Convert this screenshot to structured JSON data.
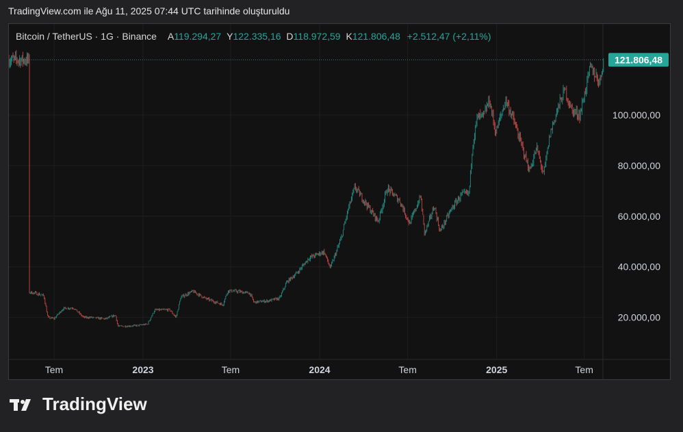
{
  "header": {
    "title": "TradingView.com ile Ağu 11, 2025 07:44 UTC tarihinde oluşturuldu"
  },
  "legend": {
    "symbol": "Bitcoin / TetherUS · 1G · Binance",
    "open_label": "A",
    "open": "119.294,27",
    "high_label": "Y",
    "high": "122.335,16",
    "low_label": "D",
    "low": "118.972,59",
    "close_label": "K",
    "close": "121.806,48",
    "change": "+2.512,47 (+2,11%)"
  },
  "price_tag": "121.806,48",
  "brand": {
    "name": "TradingView"
  },
  "colors": {
    "up": "#26a69a",
    "down": "#ef5350",
    "background": "#121213",
    "grid": "#1f1f21",
    "axis_text": "#d1d4dc"
  },
  "chart_data": {
    "type": "line",
    "style": "candlestick",
    "interval": "1 day",
    "x_tick_labels": [
      "Tem",
      "2023",
      "Tem",
      "2024",
      "Tem",
      "2025",
      "Tem"
    ],
    "y_tick_labels": [
      "20.000,00",
      "40.000,00",
      "60.000,00",
      "80.000,00",
      "100.000,00"
    ],
    "ylim": [
      0,
      135000
    ],
    "grid": true,
    "last_price": 121806.48,
    "series": [
      {
        "x": [
          "2022-05-10",
          "2022-05-25",
          "2022-06-10",
          "2022-06-18",
          "2022-07-01",
          "2022-07-20",
          "2022-08-10",
          "2022-08-31",
          "2022-09-15",
          "2022-10-15",
          "2022-11-05",
          "2022-11-10",
          "2022-11-25",
          "2022-12-20",
          "2023-01-10",
          "2023-01-25",
          "2023-02-25",
          "2023-03-10",
          "2023-03-20",
          "2023-04-14",
          "2023-05-10",
          "2023-06-15",
          "2023-06-25",
          "2023-07-15",
          "2023-08-10",
          "2023-08-18",
          "2023-09-15",
          "2023-10-10",
          "2023-10-25",
          "2023-11-15",
          "2023-12-10",
          "2024-01-10",
          "2024-01-23",
          "2024-02-15",
          "2024-02-28",
          "2024-03-14",
          "2024-04-13",
          "2024-05-01",
          "2024-05-20",
          "2024-06-15",
          "2024-07-05",
          "2024-07-28",
          "2024-08-05",
          "2024-08-25",
          "2024-09-06",
          "2024-09-30",
          "2024-10-20",
          "2024-11-05",
          "2024-11-12",
          "2024-11-22",
          "2024-12-05",
          "2024-12-17",
          "2024-12-30",
          "2025-01-20",
          "2025-02-05",
          "2025-02-25",
          "2025-03-10",
          "2025-03-25",
          "2025-04-08",
          "2025-04-22",
          "2025-05-08",
          "2025-05-22",
          "2025-06-05",
          "2025-06-22",
          "2025-07-14",
          "2025-08-02",
          "2025-08-10"
        ],
        "y": [
          30000,
          29500,
          28500,
          20000,
          19500,
          23500,
          23800,
          20000,
          20000,
          19400,
          20900,
          16500,
          16500,
          16800,
          17300,
          22900,
          23000,
          20000,
          28000,
          30300,
          27500,
          25000,
          30500,
          30300,
          29500,
          26000,
          26500,
          27500,
          34000,
          37500,
          43500,
          46000,
          39500,
          51500,
          62000,
          71500,
          63000,
          58000,
          71000,
          66000,
          57000,
          68000,
          53000,
          64000,
          54000,
          63000,
          68500,
          69000,
          88000,
          99000,
          99500,
          106000,
          93000,
          106000,
          98000,
          86000,
          78000,
          87000,
          76300,
          93000,
          103000,
          110000,
          102000,
          100000,
          119000,
          113000,
          121800
        ]
      }
    ]
  }
}
